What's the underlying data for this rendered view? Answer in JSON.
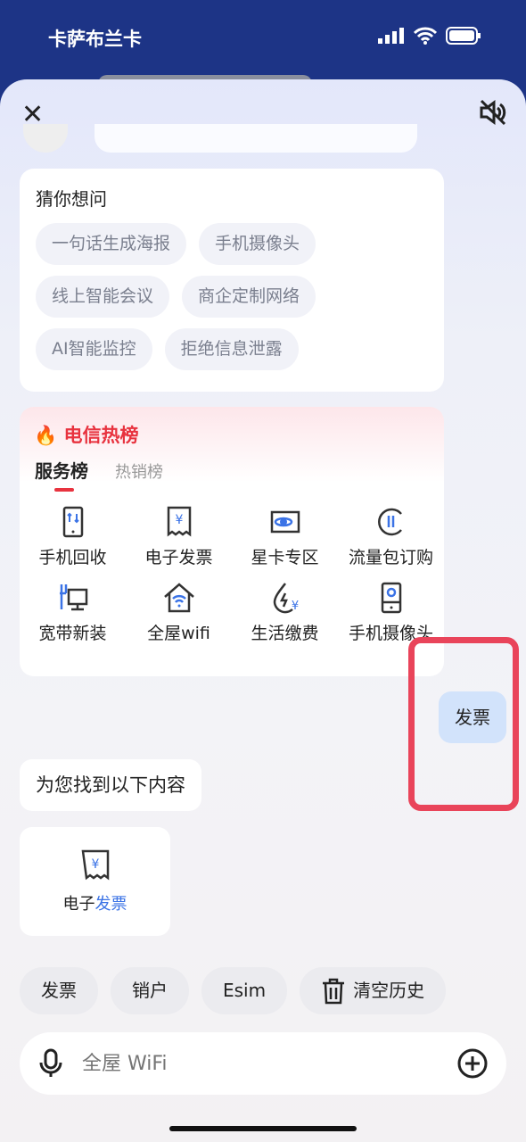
{
  "status": {
    "carrier": "卡萨布兰卡"
  },
  "guess": {
    "title": "猜你想问",
    "chips": [
      "一句话生成海报",
      "手机摄像头",
      "线上智能会议",
      "商企定制网络",
      "AI智能监控",
      "拒绝信息泄露"
    ]
  },
  "hot": {
    "title": "电信热榜",
    "tabs": [
      "服务榜",
      "热销榜"
    ],
    "items": [
      {
        "label": "手机回收",
        "icon": "phone-recycle-icon"
      },
      {
        "label": "电子发票",
        "icon": "invoice-icon"
      },
      {
        "label": "星卡专区",
        "icon": "star-card-icon"
      },
      {
        "label": "流量包订购",
        "icon": "data-package-icon"
      },
      {
        "label": "宽带新装",
        "icon": "broadband-icon"
      },
      {
        "label": "全屋wifi",
        "icon": "home-wifi-icon"
      },
      {
        "label": "生活缴费",
        "icon": "utility-payment-icon"
      },
      {
        "label": "手机摄像头",
        "icon": "phone-camera-icon"
      }
    ]
  },
  "chat": {
    "user_message": "发票",
    "reply": "为您找到以下内容",
    "result": {
      "prefix": "电子",
      "highlight": "发票"
    }
  },
  "quick": [
    "发票",
    "销户",
    "Esim"
  ],
  "clear_history": "清空历史",
  "input": {
    "placeholder": "全屋 WiFi"
  },
  "colors": {
    "accent": "#3b73e6",
    "hot": "#e8333f",
    "highlight_box": "#e9445a"
  }
}
